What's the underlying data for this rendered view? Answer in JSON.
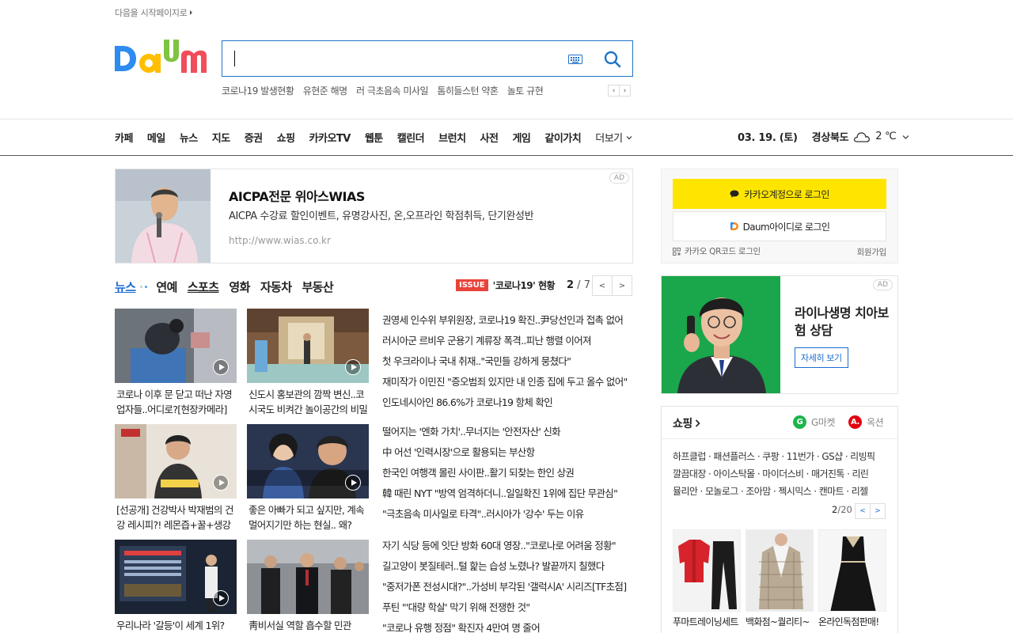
{
  "top": {
    "start_page": "다음을 시작페이지로"
  },
  "search": {
    "value": "",
    "placeholder": "",
    "keywords": [
      "코로나19 발생현황",
      "유현준 해명",
      "러 극초음속 미사일",
      "톰히들스턴 약혼",
      "놀토 규현"
    ]
  },
  "nav": {
    "items": [
      "카페",
      "메일",
      "뉴스",
      "지도",
      "증권",
      "쇼핑",
      "카카오TV",
      "웹툰",
      "캘린더",
      "브런치",
      "사전",
      "게임",
      "같이가치"
    ],
    "more": "더보기"
  },
  "weather": {
    "date": "03. 19. (토)",
    "region": "경상북도",
    "temp": "2 ℃",
    "icon": "cloud-icon"
  },
  "ad_banner": {
    "title": "AICPA전문 위아스WIAS",
    "desc": "AICPA 수강료 할인이벤트, 유명강사진, 온,오프라인 학점취득, 단기완성반",
    "url": "http://www.wias.co.kr",
    "badge": "AD"
  },
  "news": {
    "tabs": [
      "뉴스",
      "연예",
      "스포츠",
      "영화",
      "자동차",
      "부동산"
    ],
    "issue_badge": "ISSUE",
    "issue_text": "'코로나19' 현황",
    "page_current": "2",
    "page_total": " / 7",
    "cards": [
      {
        "caption": "코로나 이후 문 닫고 떠난 자영업자들..어디로?[현장카메라]",
        "video": true
      },
      {
        "caption": "신도시 홍보관의 깜짝 변신..코시국도 비켜간 놀이공간의 비밀",
        "video": true
      },
      {
        "caption": "[선공개] 건강박사 박재범의 건강 레시피?! 레몬즙+꿀+생강",
        "video": true
      },
      {
        "caption": "좋은 아빠가 되고 싶지만, 계속 멀어지기만 하는 현실.. 왜?",
        "video": true
      },
      {
        "caption": "우리나라 '갈등'이 세계 1위?",
        "video": true
      },
      {
        "caption": "靑비서실 역할 흡수할 민관",
        "video": false
      }
    ],
    "headlines_1": [
      "권영세 인수위 부위원장, 코로나19 확진..尹당선인과 접촉 없어",
      "러시아군 르비우 군용기 계류장 폭격..피난 행렬 이어져",
      "첫 우크라이나 국내 취재..\"국민들 강하게 뭉쳤다\"",
      "재미작가 이민진 \"증오범죄 있지만 내 인종 집에 두고 올수 없어\"",
      "인도네시아인 86.6%가 코로나19 항체 확인"
    ],
    "headlines_2": [
      "떨어지는 '엔화 가치'..무너지는 '안전자산' 신화",
      "中 어선 '인력시장'으로 활용되는 부산항",
      "한국인 여행객 몰린 사이판..활기 되찾는 한인 상권",
      "韓 때린 NYT \"방역 엄격하더니..일일확진 1위에 집단 무관심\"",
      "\"극초음속 미사일로 타격\"..러시아가 '강수' 두는 이유"
    ],
    "headlines_3": [
      "자기 식당 등에 잇단 방화 60대 영장..\"코로나로 어려움 정황\"",
      "길고양이 봇질테러..털 핥는 습성 노렸나? 발끝까지 칠했다",
      "\"중저가폰 전성시대?\"..가성비 부각된 '갤럭시A' 시리즈[TF초점]",
      "푸틴 \"'대량 학살' 막기 위해 전쟁한 것\"",
      "\"코로나 유행 정점\" 확진자 4만여 명 줄어"
    ]
  },
  "login": {
    "kakao": "카카오계정으로 로그인",
    "daum": "Daum아이디로 로그인",
    "qr": "카카오 QR코드 로그인",
    "signup": "회원가입"
  },
  "ad_side": {
    "title": "라이나생명 치아보험 상담",
    "cta": "자세히 보기",
    "badge": "AD"
  },
  "shopping": {
    "title": "쇼핑",
    "gmarket": "G마켓",
    "auction": "옥션",
    "links": [
      "하프클럽 · 패션플러스 · 쿠팡 · 11번가 · GS샵 · 리빙픽",
      "깔끔대장 · 아이스탁몰 · 마이더스비 · 매거진톡 · 리린",
      "뮬리안 · 모놀로그 · 조아맘 · 젝시믹스 · 캔마트 · 리젤"
    ],
    "page_current": "2",
    "page_total": "/20",
    "products": [
      "푸마트레이닝세트",
      "백화점~퀄리티~",
      "온라인독점판매!"
    ]
  },
  "colors": {
    "accent": "#1f73c8",
    "kakao": "#fee500",
    "issue": "#e8433a"
  }
}
